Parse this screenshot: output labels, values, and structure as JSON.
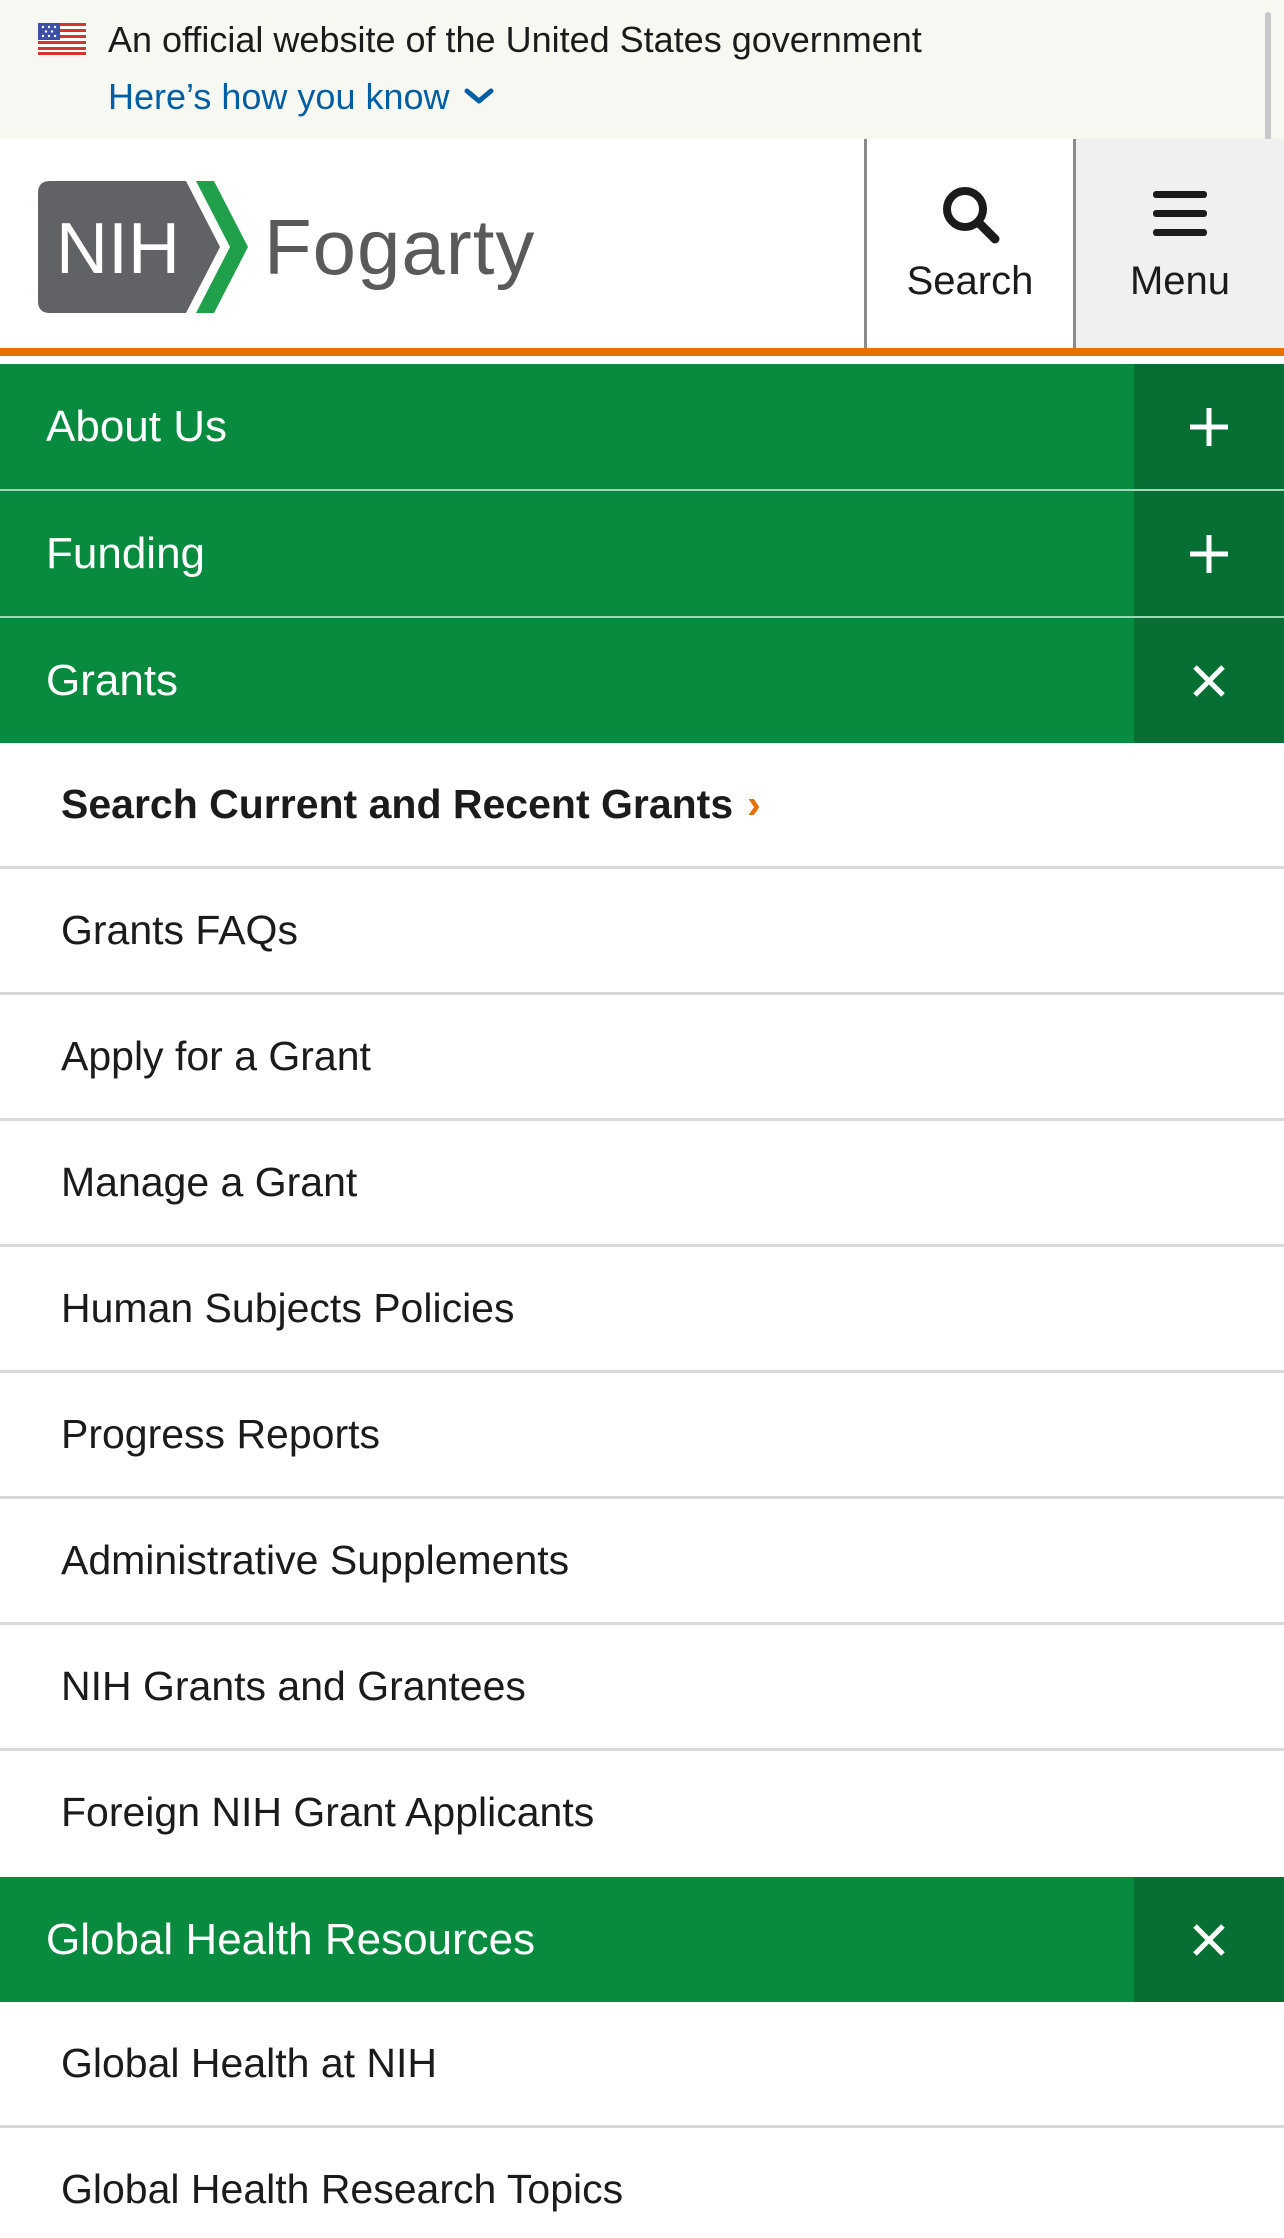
{
  "gov_banner": {
    "text": "An official website of the United States government",
    "link": "Here’s how you know"
  },
  "header": {
    "logo_mark": "NIH",
    "logo_word": "Fogarty",
    "search_label": "Search",
    "menu_label": "Menu"
  },
  "colors": {
    "nav_green": "#088a3f",
    "toggle_green": "#076e34",
    "accent_orange": "#e57200",
    "link_blue": "#005ea2"
  },
  "nav": {
    "about": "About Us",
    "funding": "Funding",
    "grants": "Grants",
    "grants_items": [
      "Search Current and Recent Grants",
      "Grants FAQs",
      "Apply for a Grant",
      "Manage a Grant",
      "Human Subjects Policies",
      "Progress Reports",
      "Administrative Supplements",
      "NIH Grants and Grantees",
      "Foreign NIH Grant Applicants"
    ],
    "featured_chevron": "›",
    "ghr": "Global Health Resources",
    "ghr_items": [
      "Global Health at NIH",
      "Global Health Research Topics"
    ]
  },
  "icons": {
    "flag": "us-flag-icon",
    "chevron": "chevron-down-icon",
    "search": "search-icon",
    "menu": "hamburger-menu-icon",
    "expand": "plus-icon",
    "collapse": "close-icon"
  }
}
